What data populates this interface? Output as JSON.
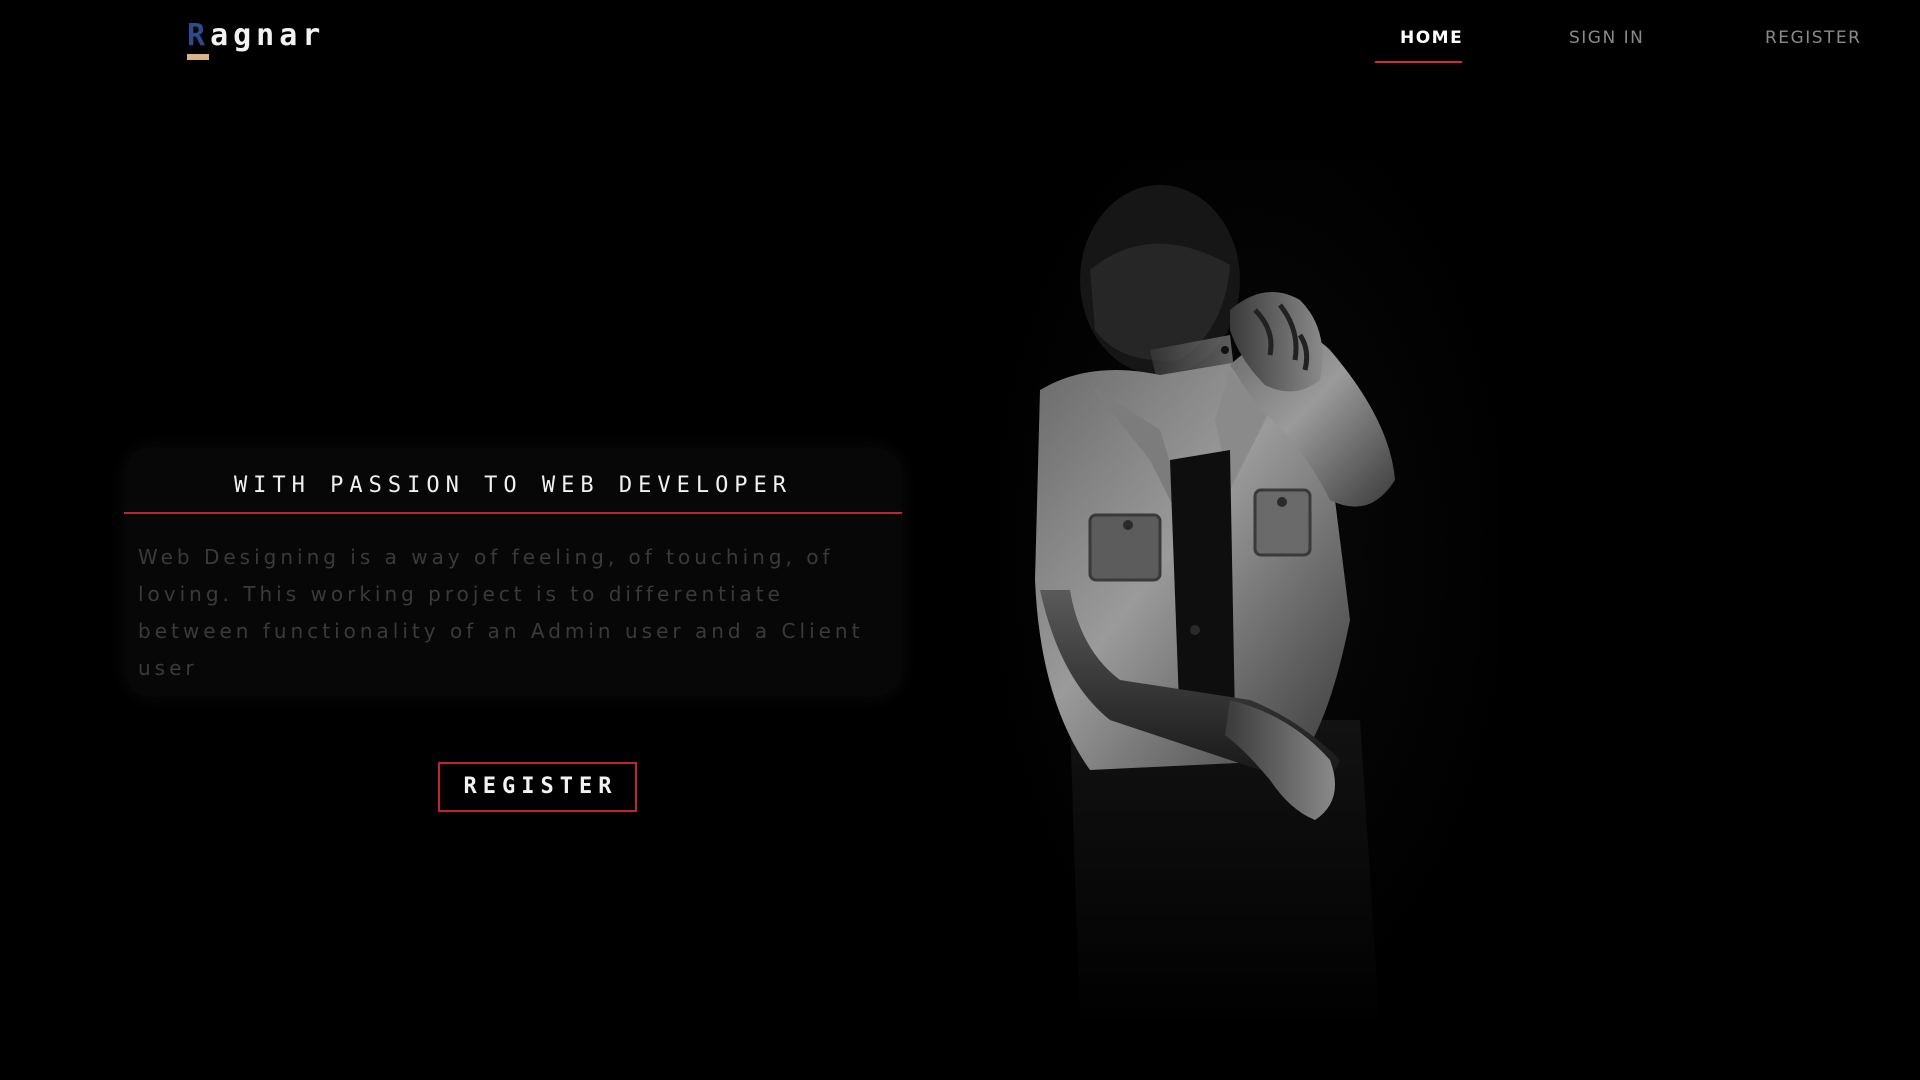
{
  "brand": {
    "first_letter": "R",
    "rest": "agnar",
    "accent_color": "#2c4a8c",
    "underline_color": "#d9b48a"
  },
  "nav": {
    "home": "HOME",
    "sign_in": "SIGN IN",
    "register": "REGISTER",
    "active_underline_color": "#d22b3a"
  },
  "hero": {
    "title": "WITH PASSION TO WEB DEVELOPER",
    "description": "Web Designing is a way of feeling, of touching, of loving. This working project is to differentiate between functionality of an Admin user and a Client user",
    "divider_color": "#c0242f"
  },
  "cta": {
    "register_label": "REGISTER",
    "border_color": "#c0242f"
  },
  "image": {
    "subject": "man in denim jacket with tattooed hand on neck, black and white photo"
  },
  "colors": {
    "background": "#000000",
    "muted_text": "#3a3a3c",
    "nav_inactive": "#8a8a8a"
  }
}
